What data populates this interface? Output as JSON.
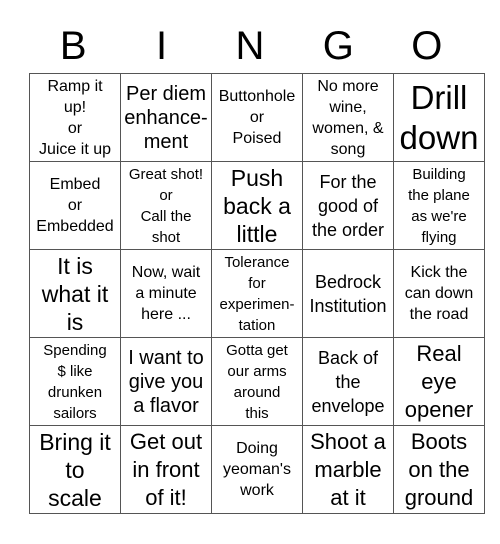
{
  "header": {
    "letters": [
      "B",
      "I",
      "N",
      "G",
      "O"
    ]
  },
  "board": {
    "rows": [
      {
        "cells": [
          {
            "text": "Ramp it up!\nor\nJuice it up",
            "lines": [
              "Ramp it",
              "up!",
              "or",
              "Juice it up"
            ]
          },
          {
            "text": "Per diem enhancement",
            "lines": [
              "Per diem",
              "enhance-",
              "ment"
            ]
          },
          {
            "text": "Buttonhole or Poised",
            "lines": [
              "Buttonhole",
              "or",
              "Poised"
            ]
          },
          {
            "text": "No more wine, women, & song",
            "lines": [
              "No more",
              "wine,",
              "women, &",
              "song"
            ]
          },
          {
            "text": "Drill down",
            "lines": [
              "Drill",
              "down"
            ]
          }
        ]
      },
      {
        "cells": [
          {
            "text": "Embed or Embedded",
            "lines": [
              "Embed",
              "or",
              "Embedded"
            ]
          },
          {
            "text": "Great shot! or Call the shot",
            "lines": [
              "Great shot!",
              "or",
              "Call the",
              "shot"
            ]
          },
          {
            "text": "Push back a little",
            "lines": [
              "Push",
              "back a",
              "little"
            ]
          },
          {
            "text": "For the good of the order",
            "lines": [
              "For the",
              "good of",
              "the order"
            ]
          },
          {
            "text": "Building the plane as we're flying",
            "lines": [
              "Building",
              "the plane",
              "as we're",
              "flying"
            ]
          }
        ]
      },
      {
        "cells": [
          {
            "text": "It is what it is",
            "lines": [
              "It is",
              "what it",
              "is"
            ]
          },
          {
            "text": "Now, wait a minute here ...",
            "lines": [
              "Now, wait",
              "a minute",
              "here ..."
            ]
          },
          {
            "text": "Tolerance for experimentation",
            "lines": [
              "Tolerance",
              "for",
              "experimen-",
              "tation"
            ]
          },
          {
            "text": "Bedrock Institution",
            "lines": [
              "Bedrock",
              "Institution"
            ]
          },
          {
            "text": "Kick the can down the road",
            "lines": [
              "Kick the",
              "can down",
              "the road"
            ]
          }
        ]
      },
      {
        "cells": [
          {
            "text": "Spending $ like drunken sailors",
            "lines": [
              "Spending",
              "$ like",
              "drunken",
              "sailors"
            ]
          },
          {
            "text": "I want to give you a flavor",
            "lines": [
              "I want to",
              "give you",
              "a flavor"
            ]
          },
          {
            "text": "Gotta get our arms around this",
            "lines": [
              "Gotta get",
              "our arms",
              "around",
              "this"
            ]
          },
          {
            "text": "Back of the envelope",
            "lines": [
              "Back of",
              "the",
              "envelope"
            ]
          },
          {
            "text": "Real eye opener",
            "lines": [
              "Real",
              "eye",
              "opener"
            ]
          }
        ]
      },
      {
        "cells": [
          {
            "text": "Bring it to scale",
            "lines": [
              "Bring it",
              "to",
              "scale"
            ]
          },
          {
            "text": "Get out in front of it!",
            "lines": [
              "Get out",
              "in front",
              "of it!"
            ]
          },
          {
            "text": "Doing yeoman's work",
            "lines": [
              "Doing",
              "yeoman's",
              "work"
            ]
          },
          {
            "text": "Shoot a marble at it",
            "lines": [
              "Shoot a",
              "marble",
              "at it"
            ]
          },
          {
            "text": "Boots on the ground",
            "lines": [
              "Boots",
              "on the",
              "ground"
            ]
          }
        ]
      }
    ]
  }
}
